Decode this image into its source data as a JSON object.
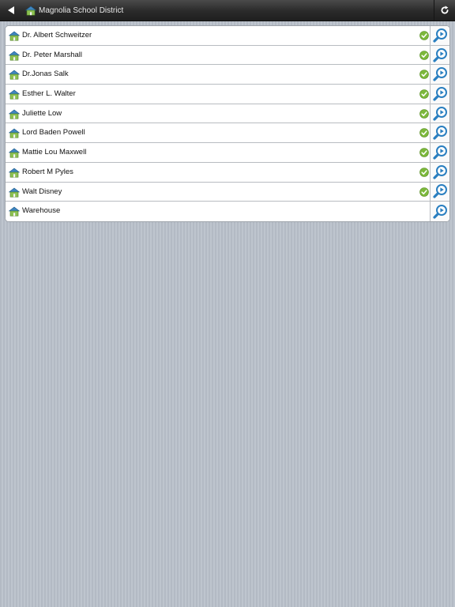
{
  "header": {
    "title": "Magnolia School District",
    "back_icon": "back-arrow-icon",
    "title_icon": "school-house-icon",
    "refresh_icon": "refresh-icon"
  },
  "colors": {
    "house_roof": "#2c6f9e",
    "house_body": "#7ab648",
    "check_green": "#7cb83b",
    "zoom_blue": "#2a7fc0"
  },
  "schools": [
    {
      "name": "Dr. Albert Schweitzer",
      "checked": true
    },
    {
      "name": "Dr. Peter Marshall",
      "checked": true
    },
    {
      "name": "Dr.Jonas Salk",
      "checked": true
    },
    {
      "name": "Esther L. Walter",
      "checked": true
    },
    {
      "name": "Juliette Low",
      "checked": true
    },
    {
      "name": "Lord Baden Powell",
      "checked": true
    },
    {
      "name": "Mattie Lou Maxwell",
      "checked": true
    },
    {
      "name": "Robert M Pyles",
      "checked": true
    },
    {
      "name": "Walt Disney",
      "checked": true
    },
    {
      "name": "Warehouse",
      "checked": false
    }
  ]
}
